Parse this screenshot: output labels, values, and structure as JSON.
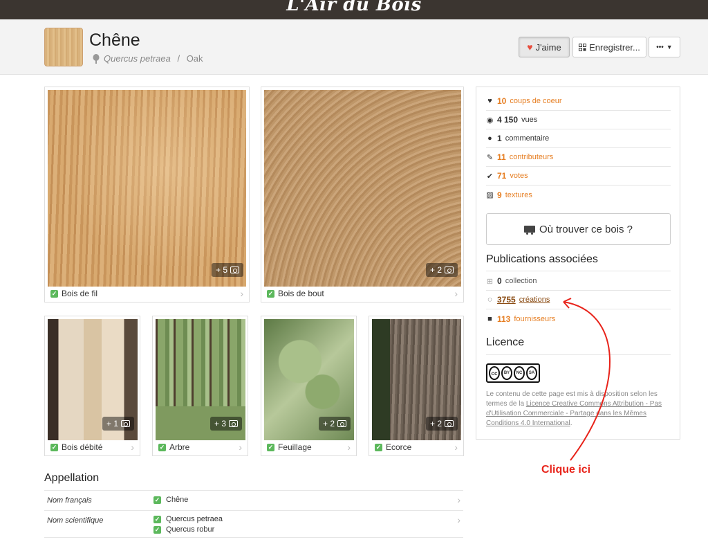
{
  "site": {
    "logo": "L'Air du Bois"
  },
  "header": {
    "title": "Chêne",
    "scientific_name": "Quercus petraea",
    "separator": " / ",
    "common_name": "Oak",
    "like_label": "J'aime",
    "save_label": "Enregistrer...",
    "more_label": "•••"
  },
  "photos": [
    {
      "caption": "Bois de fil",
      "badge": "+ 5"
    },
    {
      "caption": "Bois de bout",
      "badge": "+ 2"
    },
    {
      "caption": "Bois débité",
      "badge": "+ 1"
    },
    {
      "caption": "Arbre",
      "badge": "+ 3"
    },
    {
      "caption": "Feuillage",
      "badge": "+ 2"
    },
    {
      "caption": "Ecorce",
      "badge": "+ 2"
    }
  ],
  "stats": [
    {
      "icon": "heart-icon",
      "value": "10",
      "label": "coups de coeur"
    },
    {
      "icon": "eye-icon",
      "value": "4 150",
      "label": "vues"
    },
    {
      "icon": "comment-icon",
      "value": "1",
      "label": "commentaire"
    },
    {
      "icon": "contributor-icon",
      "value": "11",
      "label": "contributeurs"
    },
    {
      "icon": "check-icon",
      "value": "71",
      "label": "votes"
    },
    {
      "icon": "texture-icon",
      "value": "9",
      "label": "textures"
    }
  ],
  "find_button": "Où trouver ce bois ?",
  "publications": {
    "title": "Publications associées",
    "items": [
      {
        "icon": "collection-icon",
        "value": "0",
        "label": "collection"
      },
      {
        "icon": "creation-icon",
        "value": "3755",
        "label": "créations"
      },
      {
        "icon": "truck-icon",
        "value": "113",
        "label": "fournisseurs"
      }
    ]
  },
  "licence": {
    "title": "Licence",
    "badge": {
      "cc": "cc",
      "by": "BY",
      "nc": "NC",
      "sa": "SA"
    },
    "text_before": "Le contenu de cette page est mis à disposition selon les termes de la ",
    "link": "Licence Creative Commons Attribution - Pas d'Utilisation Commerciale - Partage dans les Mêmes Conditions 4.0 International",
    "text_after": "."
  },
  "appellation": {
    "title": "Appellation",
    "rows": [
      {
        "label": "Nom français",
        "values": [
          "Chêne"
        ]
      },
      {
        "label": "Nom scientifique",
        "values": [
          "Quercus petraea",
          "Quercus robur"
        ]
      }
    ]
  },
  "annotation": {
    "text": "Clique ici",
    "color": "#e8231a"
  },
  "colors": {
    "accent": "#e67e22",
    "check": "#5cb85c",
    "topbar": "#3b3530"
  }
}
